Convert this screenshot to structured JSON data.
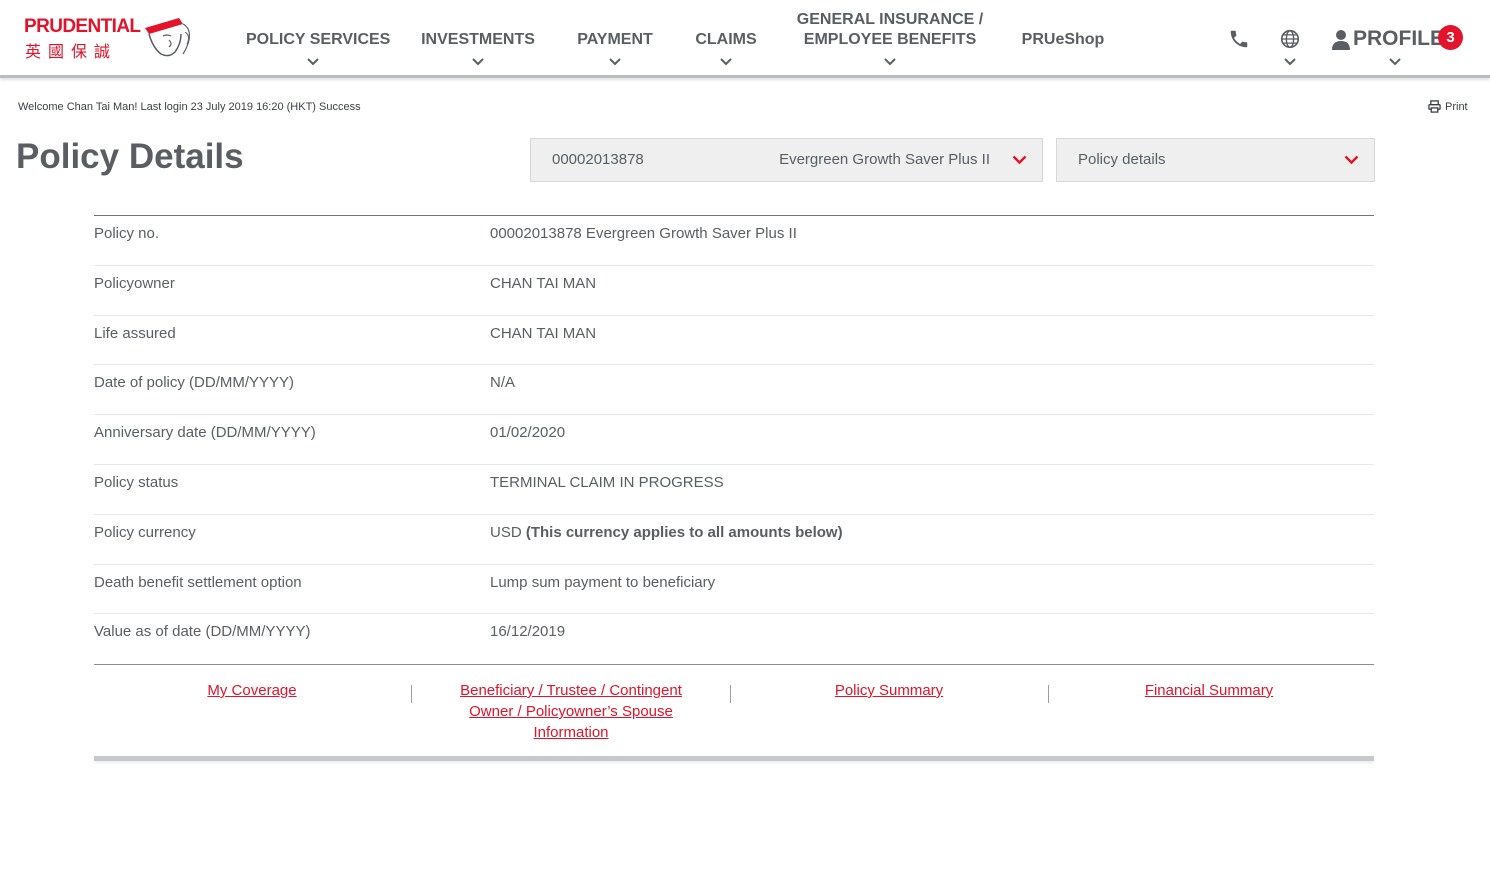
{
  "logo": {
    "brand": "PRUDENTIAL",
    "chinese": "英國保誠"
  },
  "nav": {
    "policy_services": "POLICY SERVICES",
    "investments": "INVESTMENTS",
    "payment": "PAYMENT",
    "claims": "CLAIMS",
    "general_line1": "GENERAL INSURANCE /",
    "general_line2": "EMPLOYEE BENEFITS",
    "prueshop": "PRUeShop",
    "profile": "PROFILE",
    "profile_badge": "3",
    "icons": [
      "phone-icon",
      "globe-icon",
      "user-icon"
    ]
  },
  "welcome": "Welcome Chan Tai Man! Last login 23 July 2019 16:20 (HKT) Success",
  "print_label": "Print",
  "page_title": "Policy Details",
  "policy_select": {
    "number": "00002013878",
    "name": "Evergreen Growth Saver Plus II"
  },
  "view_select": {
    "label": "Policy details"
  },
  "details": [
    {
      "label": "Policy no.",
      "value": "00002013878 Evergreen Growth Saver Plus II",
      "note": ""
    },
    {
      "label": "Policyowner",
      "value": "CHAN TAI MAN",
      "note": ""
    },
    {
      "label": "Life assured",
      "value": "CHAN TAI MAN",
      "note": ""
    },
    {
      "label": "Date of policy (DD/MM/YYYY)",
      "value": "N/A",
      "note": ""
    },
    {
      "label": "Anniversary date (DD/MM/YYYY)",
      "value": "01/02/2020",
      "note": ""
    },
    {
      "label": "Policy status",
      "value": "TERMINAL CLAIM IN PROGRESS",
      "note": ""
    },
    {
      "label": "Policy currency",
      "value": "USD",
      "note": "(This currency applies to all amounts below)"
    },
    {
      "label": "Death benefit settlement option",
      "value": "Lump sum payment to beneficiary",
      "note": ""
    },
    {
      "label": "Value as of date (DD/MM/YYYY)",
      "value": "16/12/2019",
      "note": ""
    }
  ],
  "links": {
    "my_coverage": "My Coverage",
    "beneficiary_line1": "Beneficiary / Trustee / Contingent",
    "beneficiary_line2": "Owner / Policyowner’s Spouse",
    "beneficiary_line3": "Information",
    "policy_summary": "Policy Summary",
    "financial_summary": "Financial Summary"
  },
  "colors": {
    "brand_red": "#e2132a",
    "text_gray": "#5a5e63",
    "select_bg": "#efeff0"
  }
}
